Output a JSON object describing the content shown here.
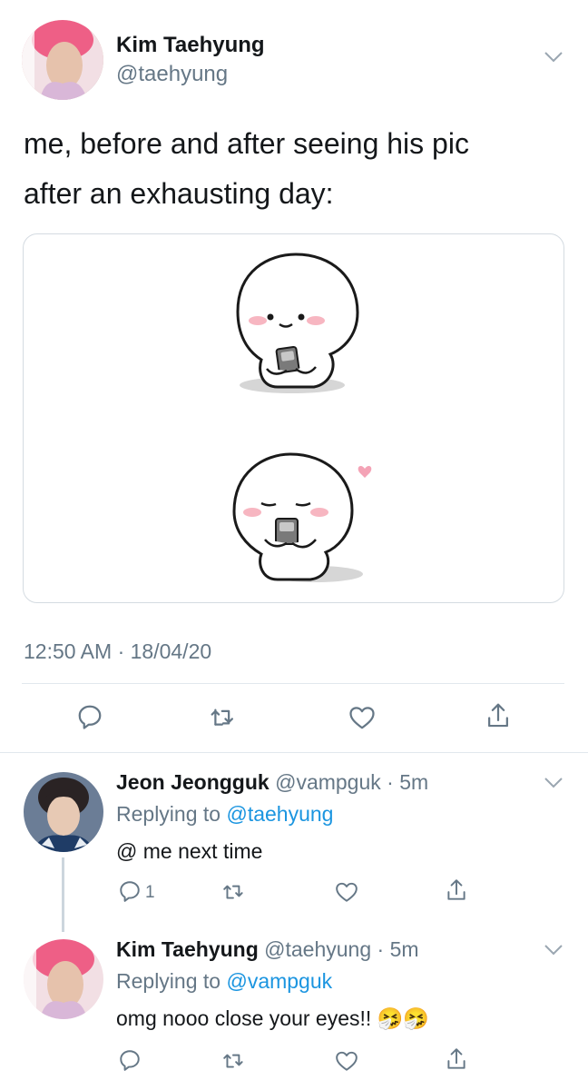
{
  "main_tweet": {
    "author_name": "Kim Taehyung",
    "author_handle": "@taehyung",
    "text_line1": "me, before and after seeing his pic",
    "text_line2": "after an exhausting day:",
    "timestamp": "12:50 AM · 18/04/20"
  },
  "replies": [
    {
      "author_name": "Jeon Jeongguk",
      "author_handle": "@vampguk",
      "time": "· 5m",
      "replying_prefix": "Replying to",
      "replying_to": "@taehyung",
      "text": "@ me next time",
      "reply_count": "1"
    },
    {
      "author_name": "Kim Taehyung",
      "author_handle": "@taehyung",
      "time": "· 5m",
      "replying_prefix": "Replying to",
      "replying_to": "@vampguk",
      "text": "omg nooo close your eyes!!",
      "emoji": "🤧🤧"
    }
  ],
  "icons": {
    "reply": "reply-icon",
    "retweet": "retweet-icon",
    "like": "heart-icon",
    "share": "share-icon",
    "menu": "chevron-down-icon"
  },
  "colors": {
    "link": "#1b95e0",
    "secondary": "#657786",
    "divider": "#e1e8ed",
    "blush": "#f7b6c1"
  }
}
